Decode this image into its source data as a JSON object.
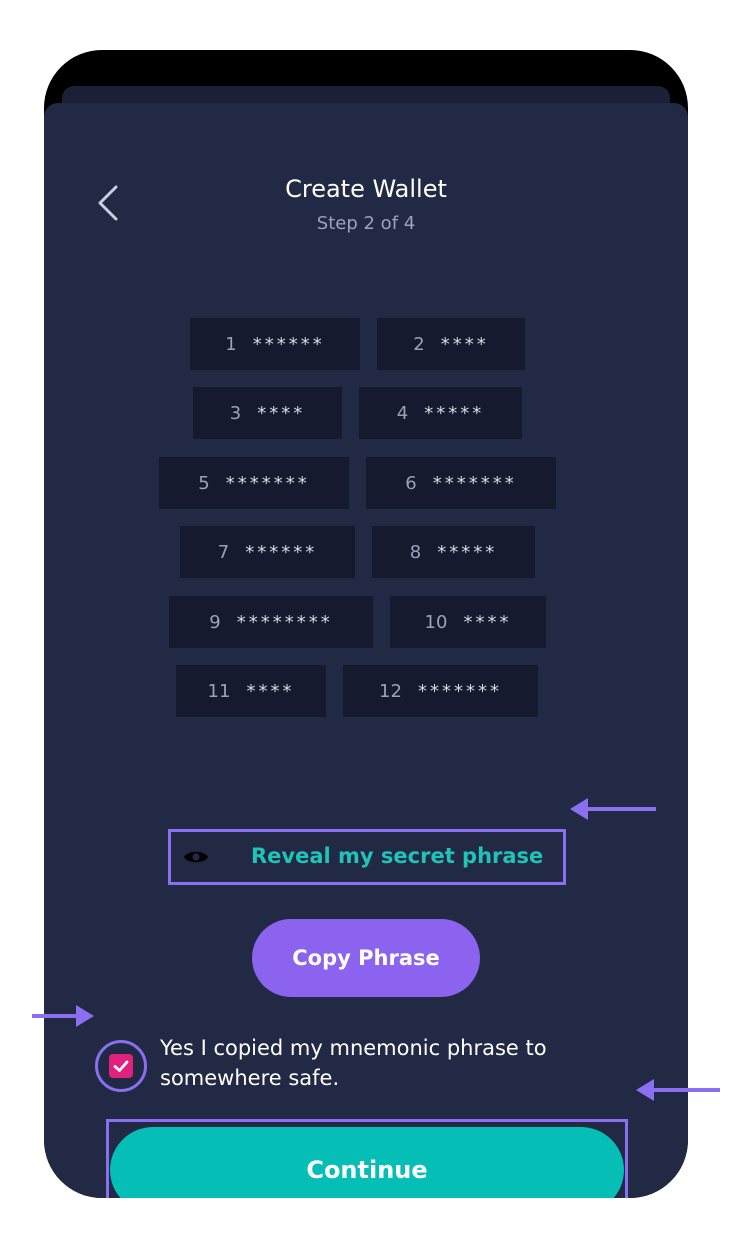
{
  "header": {
    "title": "Create Wallet",
    "step": "Step 2 of 4"
  },
  "mnemonic": {
    "words": [
      {
        "num": "1",
        "mask": "******"
      },
      {
        "num": "2",
        "mask": "****"
      },
      {
        "num": "3",
        "mask": "****"
      },
      {
        "num": "4",
        "mask": "*****"
      },
      {
        "num": "5",
        "mask": "*******"
      },
      {
        "num": "6",
        "mask": "*******"
      },
      {
        "num": "7",
        "mask": "******"
      },
      {
        "num": "8",
        "mask": "*****"
      },
      {
        "num": "9",
        "mask": "********"
      },
      {
        "num": "10",
        "mask": "****"
      },
      {
        "num": "11",
        "mask": "****"
      },
      {
        "num": "12",
        "mask": "*******"
      }
    ]
  },
  "actions": {
    "reveal_label": "Reveal my secret phrase",
    "copy_label": "Copy Phrase",
    "confirm_text": "Yes I copied my mnemonic phrase to somewhere safe.",
    "confirm_checked": true,
    "continue_label": "Continue"
  },
  "colors": {
    "background": "#222944",
    "word_box": "#151a2e",
    "accent_teal": "#05bfb6",
    "accent_purple": "#8b63ee",
    "checkbox_pink": "#e0227e",
    "annotation": "#8a6ff0"
  }
}
